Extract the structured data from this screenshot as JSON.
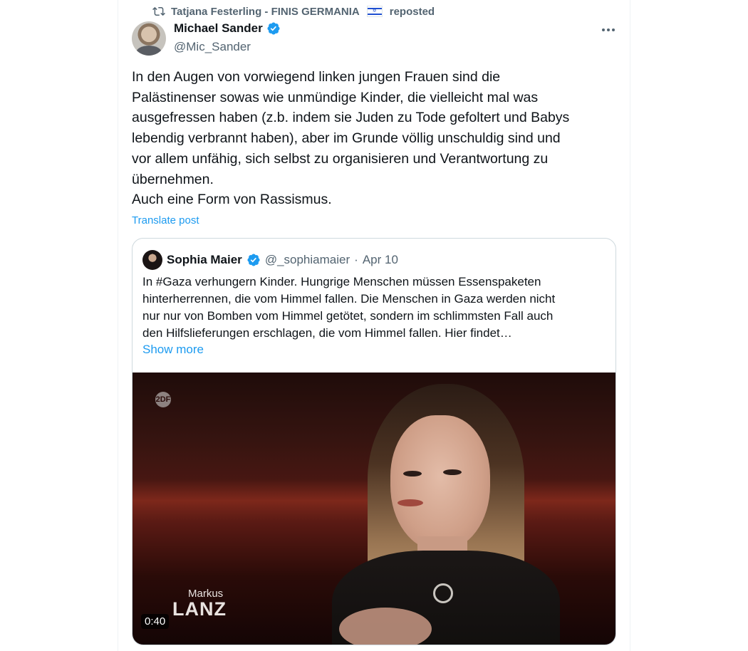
{
  "repost": {
    "icon": "repost-icon",
    "reposter": "Tatjana Festerling - FINIS GERMANIA",
    "label": "reposted"
  },
  "author": {
    "display_name": "Michael Sander",
    "handle": "@Mic_Sander",
    "verified_color": "#1d9bf0"
  },
  "tweet": {
    "text": "In den Augen von vorwiegend linken jungen Frauen sind die\nPalästinenser sowas wie unmündige Kinder, die vielleicht mal was\nausgefressen haben (z.b. indem sie Juden zu Tode gefoltert und Babys\nlebendig verbrannt haben), aber im Grunde völlig unschuldig sind und\nvor allem unfähig, sich selbst zu organisieren und Verantwortung zu\nübernehmen.\nAuch eine Form von Rassismus.",
    "translate_label": "Translate post"
  },
  "quote": {
    "display_name": "Sophia Maier",
    "handle": "@_sophiamaier",
    "separator": "·",
    "date": "Apr 10",
    "text": "In #Gaza verhungern Kinder. Hungrige Menschen müssen Essenspaketen\nhinterherrennen, die vom Himmel fallen. Die Menschen in Gaza werden nicht\nnur nur von Bomben vom Himmel getötet, sondern im schlimmsten Fall auch\nden Hilfslieferungen erschlagen, die vom Himmel fallen. Hier findet…",
    "show_more": "Show more"
  },
  "video": {
    "channel_logo_text": "2DF",
    "show_small": "Markus",
    "show_big": "LANZ",
    "duration": "0:40"
  },
  "colors": {
    "accent": "#1d9bf0",
    "muted": "#536471",
    "text": "#0f1419",
    "border": "#cfd9de"
  }
}
